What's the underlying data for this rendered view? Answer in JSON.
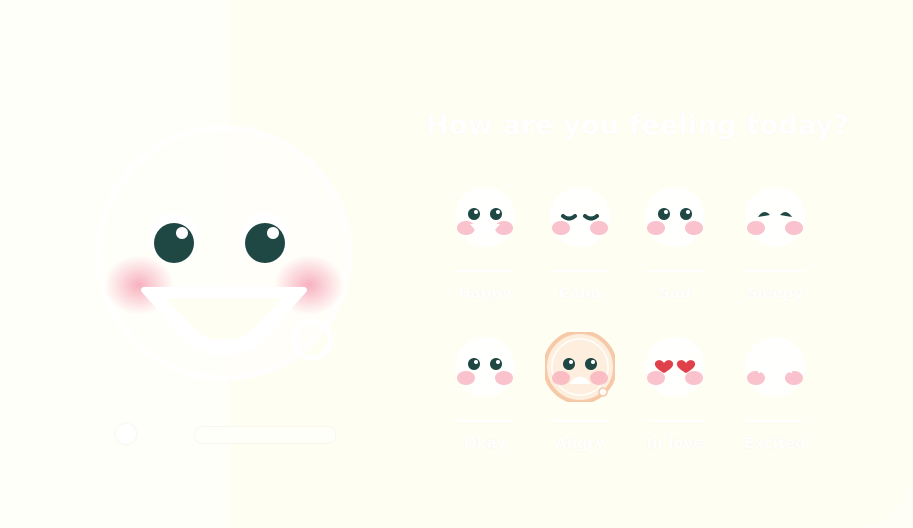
{
  "question": {
    "text": "How are you feeling today?"
  },
  "moods": [
    {
      "label": "Happy",
      "eyes": "round",
      "mouth": "grin",
      "selected": false
    },
    {
      "label": "Calm",
      "eyes": "closed",
      "mouth": "none",
      "selected": false
    },
    {
      "label": "Sad",
      "eyes": "round",
      "mouth": "none",
      "selected": false
    },
    {
      "label": "Sleepy",
      "eyes": "half",
      "mouth": "none",
      "selected": false
    },
    {
      "label": "Okay",
      "eyes": "round",
      "mouth": "none",
      "selected": false
    },
    {
      "label": "Angry",
      "eyes": "round",
      "mouth": "frown",
      "selected": true
    },
    {
      "label": "In love",
      "eyes": "hearts",
      "mouth": "none",
      "selected": false
    },
    {
      "label": "Excited",
      "eyes": "squint",
      "mouth": "none",
      "selected": false
    }
  ],
  "colors": {
    "accent": "#f6c9a8",
    "eye": "#1f4744",
    "blush": "#f7a8b8",
    "heart": "#e0404a"
  }
}
